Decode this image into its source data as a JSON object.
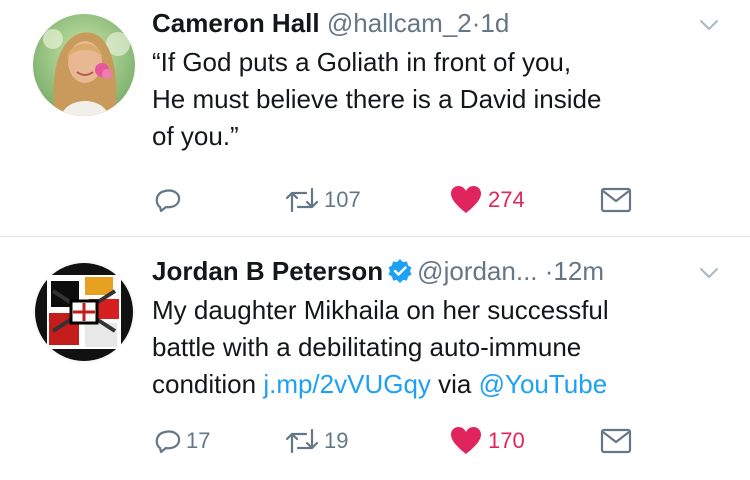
{
  "tweets": [
    {
      "author_name": "Cameron Hall",
      "handle": "@hallcam_2",
      "separator": "·",
      "time": "1d",
      "text_lines": [
        "“If God puts a Goliath in front of you,",
        "He must believe there is a David inside",
        "of you.”"
      ],
      "reply_count": "",
      "retweet_count": "107",
      "like_count": "274"
    },
    {
      "author_name": "Jordan B Peterson",
      "verified": true,
      "handle": "@jordan...",
      "separator": "·",
      "time": "12m",
      "text_lines": [
        "My daughter Mikhaila on her successful",
        "battle with a debilitating auto-immune"
      ],
      "text_line3_prefix": "condition ",
      "link_text": "j.mp/2vVUGqy",
      "text_line3_mid": " via ",
      "mention_text": "@YouTube",
      "reply_count": "17",
      "retweet_count": "19",
      "like_count": "170"
    }
  ],
  "colors": {
    "text": "#14171a",
    "muted": "#657786",
    "link": "#1da1f2",
    "like": "#e0245e",
    "divider": "#e1e8ed"
  },
  "icons": [
    "reply-icon",
    "retweet-icon",
    "heart-icon",
    "dm-icon",
    "chevron-down-icon",
    "verified-badge-icon"
  ]
}
